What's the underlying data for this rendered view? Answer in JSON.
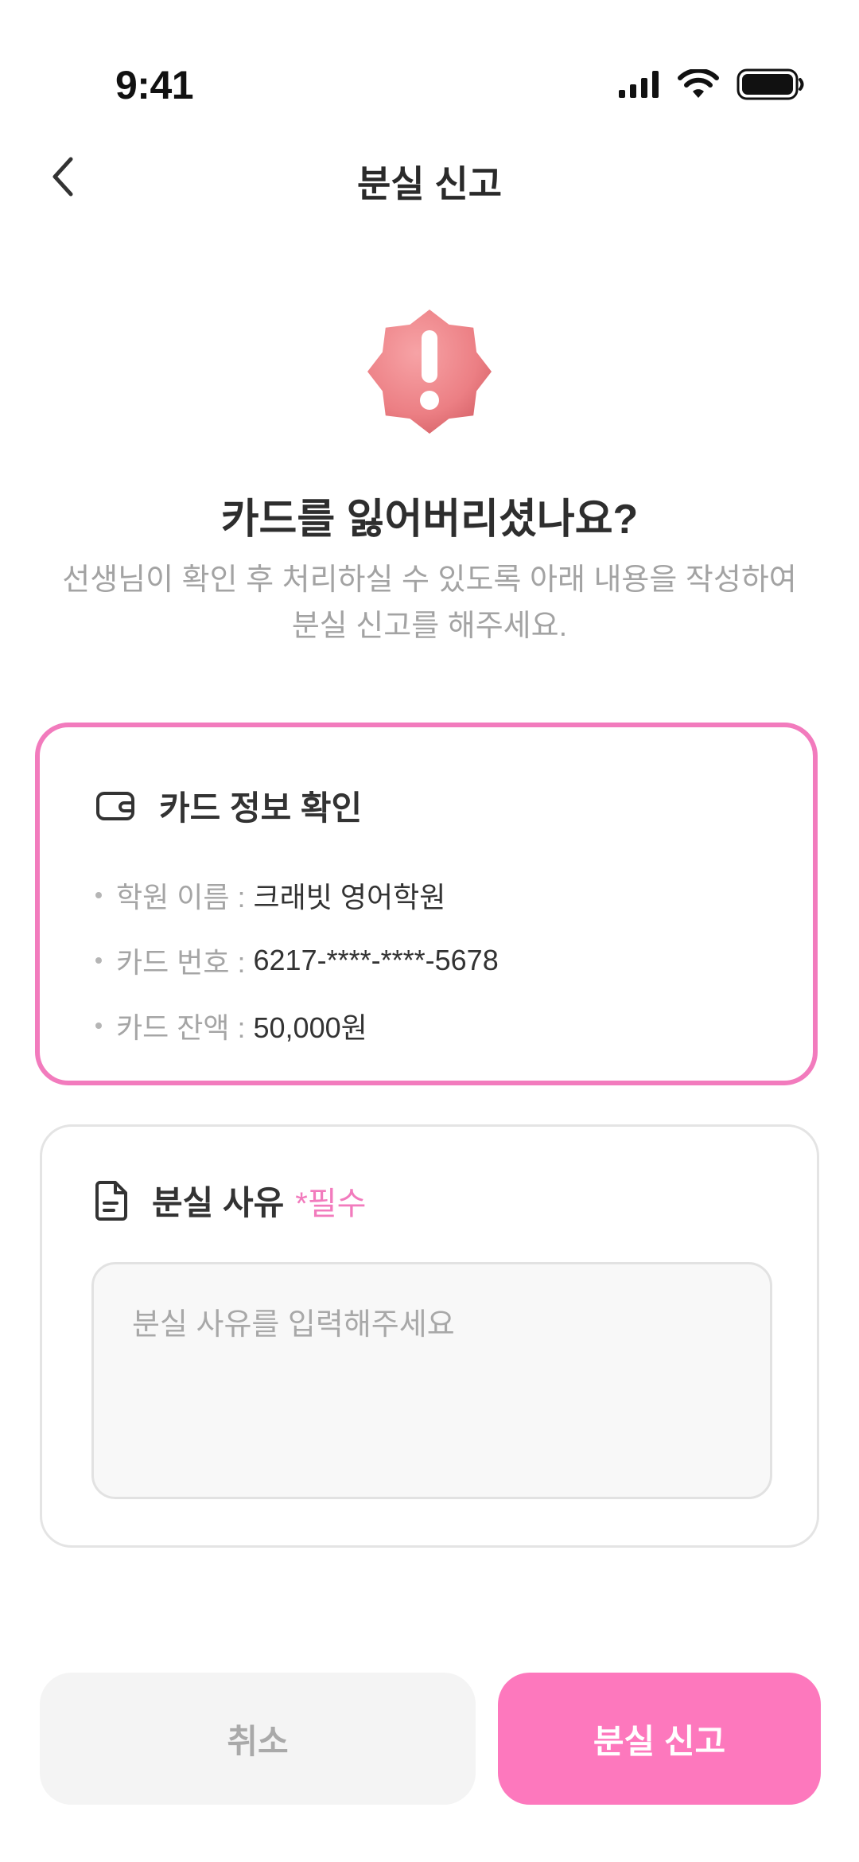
{
  "status_bar": {
    "time": "9:41",
    "icons": [
      "signal-icon",
      "wifi-icon",
      "battery-icon"
    ]
  },
  "nav": {
    "back_icon": "chevron-left-icon",
    "title": "분실 신고"
  },
  "hero": {
    "icon": "alert-badge-icon",
    "title": "카드를 잃어버리셨나요?",
    "description_line1": "선생님이 확인 후 처리하실 수 있도록 아래 내용을 작성하여",
    "description_line2": "분실 신고를 해주세요."
  },
  "card_info": {
    "icon": "wallet-icon",
    "title": "카드 정보 확인",
    "rows": [
      {
        "label": "학원 이름 :",
        "value": "크래빗 영어학원"
      },
      {
        "label": "카드 번호 :",
        "value": "6217-****-****-5678"
      },
      {
        "label": "카드 잔액 :",
        "value": "50,000원"
      }
    ]
  },
  "reason": {
    "icon": "document-icon",
    "title": "분실 사유",
    "required": "*필수",
    "placeholder": "분실 사유를 입력해주세요",
    "value": ""
  },
  "buttons": {
    "cancel": "취소",
    "submit": "분실 신고"
  },
  "colors": {
    "accent": "#fd78bd",
    "accent_border": "#f27bbd",
    "alert_badge": "#f0868a",
    "muted_text": "#a3a3a3"
  }
}
